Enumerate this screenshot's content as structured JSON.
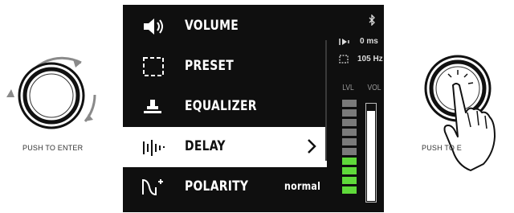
{
  "menu": {
    "items": [
      {
        "label": "VOLUME",
        "icon": "speaker-icon",
        "value": "",
        "selected": false
      },
      {
        "label": "PRESET",
        "icon": "dashed-square-icon",
        "value": "",
        "selected": false
      },
      {
        "label": "EQUALIZER",
        "icon": "equalizer-icon",
        "value": "",
        "selected": false
      },
      {
        "label": "DELAY",
        "icon": "delay-icon",
        "value": "",
        "selected": true
      },
      {
        "label": "POLARITY",
        "icon": "polarity-icon",
        "value": "normal",
        "selected": false
      }
    ]
  },
  "status": {
    "bluetooth_icon": "bluetooth-icon",
    "delay_value": "0 ms",
    "crossover_value": "105 Hz",
    "lvl_label": "LVL",
    "vol_label": "VOL",
    "lvl_segments_lit": 4,
    "lvl_segments_total": 10,
    "lvl_color": "#5fd93a",
    "vol_level": 0.93
  },
  "controls": {
    "left_caption": "PUSH TO ENTER",
    "right_caption": "PUSH TO E"
  }
}
